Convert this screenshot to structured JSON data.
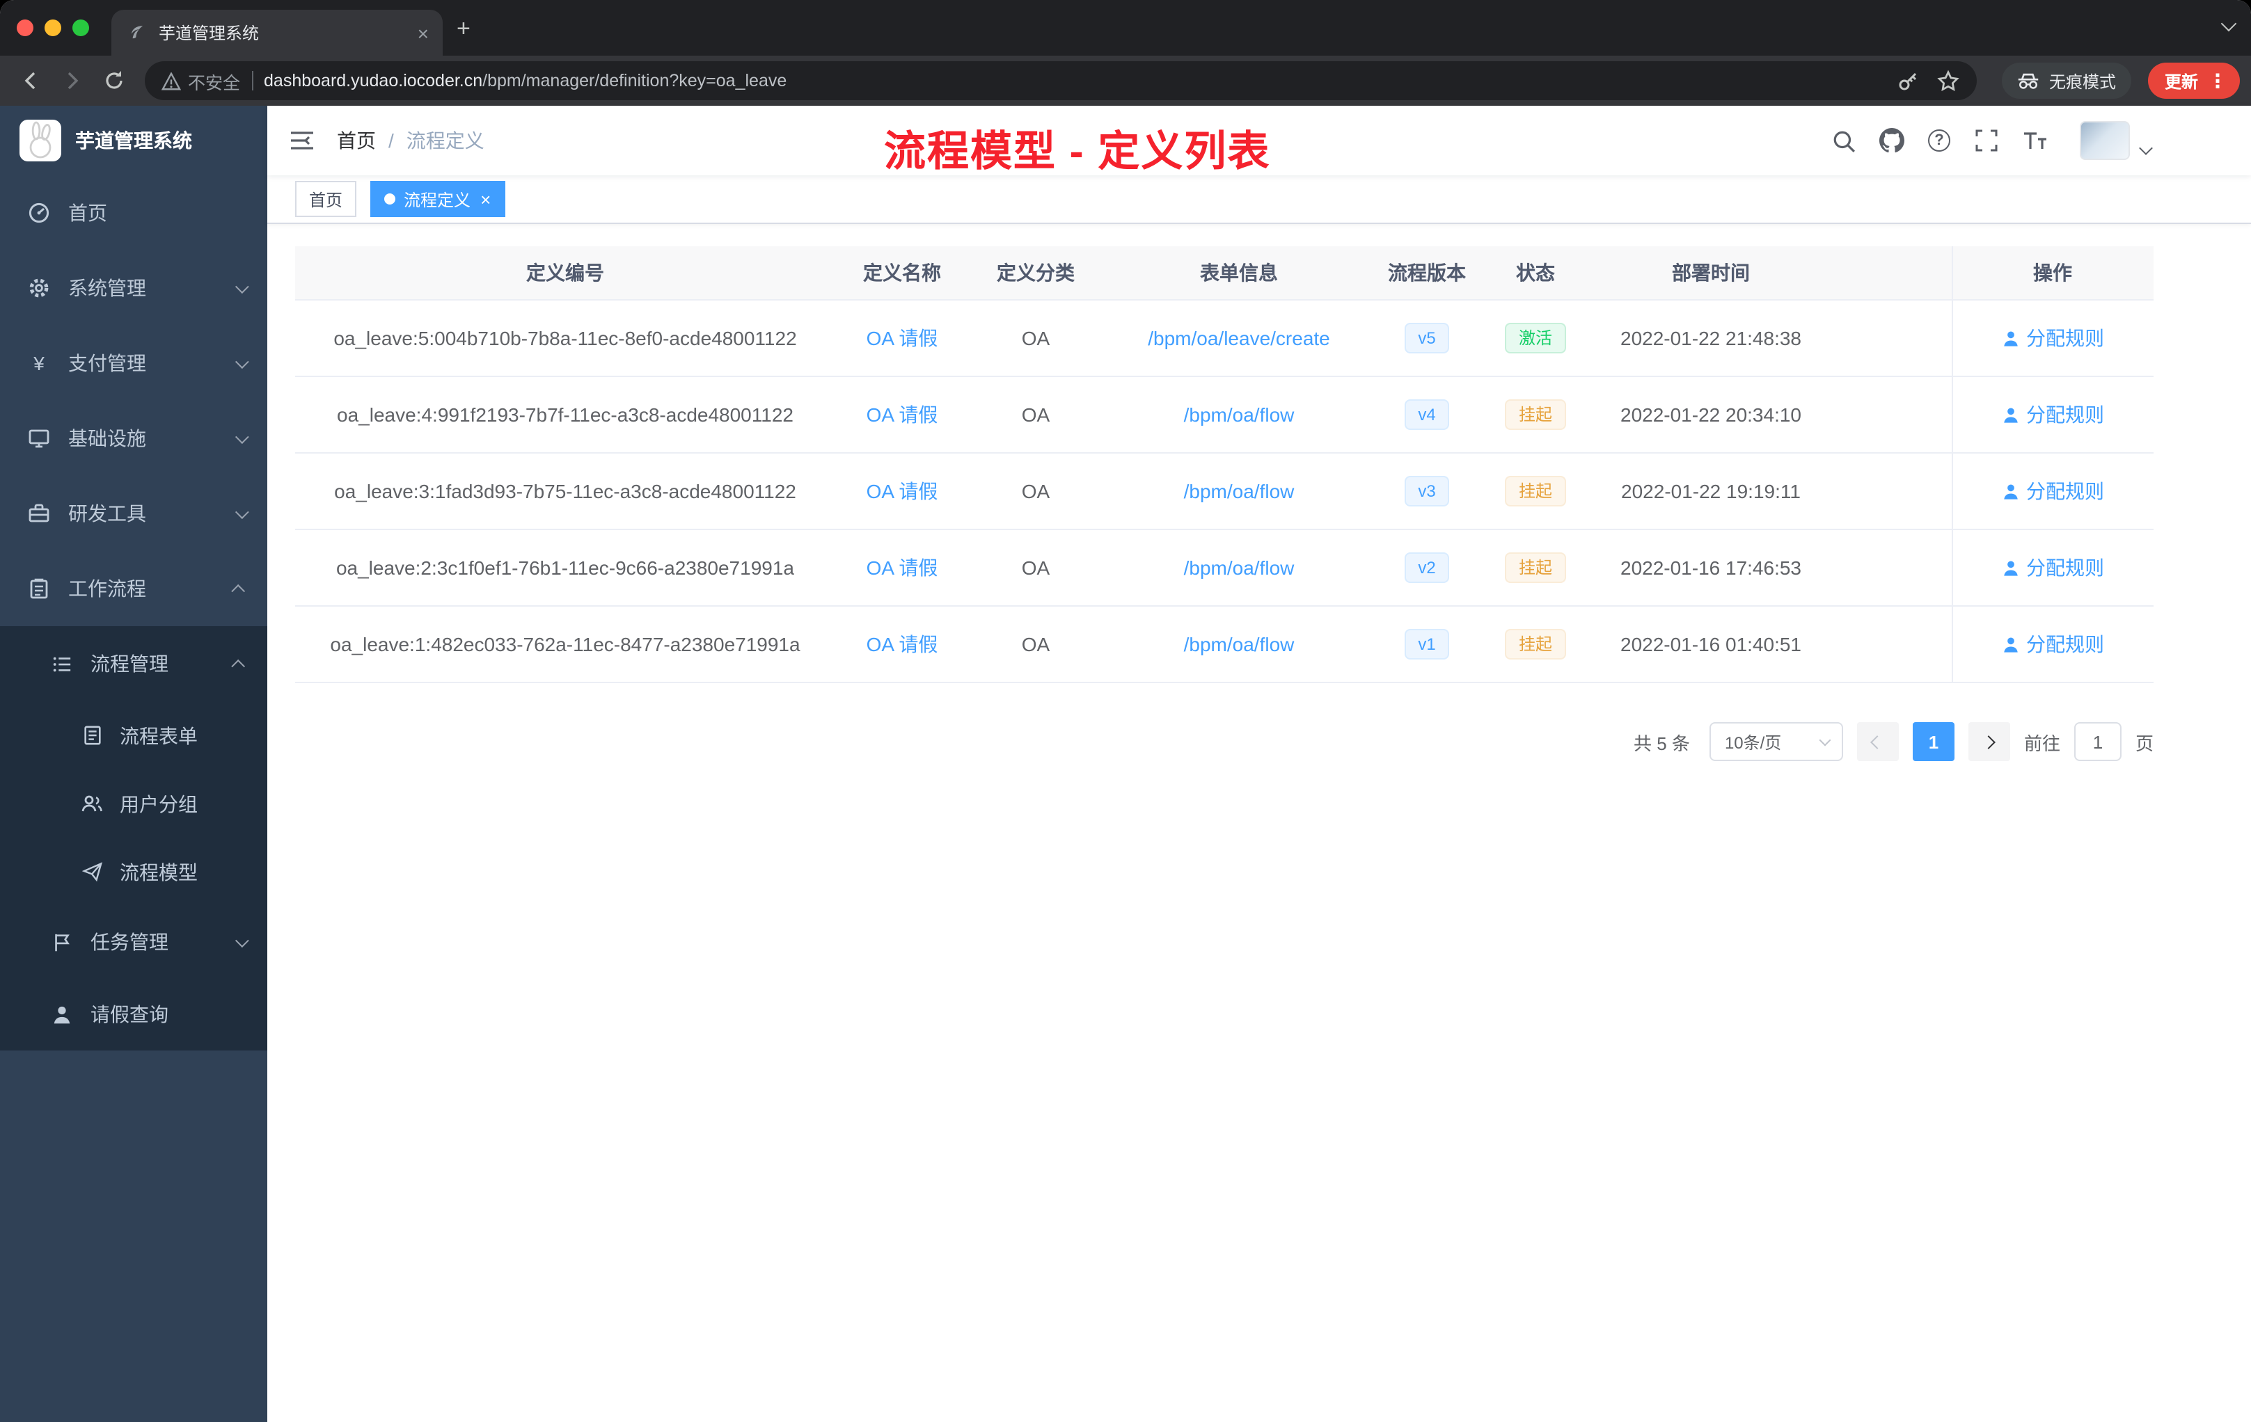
{
  "colors": {
    "accent": "#409eff",
    "title_red": "#f5222d",
    "success": "#13ce66",
    "warning": "#e6a23c",
    "sidebar_bg": "#304156",
    "submenu_bg": "#1f2d3d"
  },
  "chrome": {
    "tab_title": "芋道管理系统",
    "security_label": "不安全",
    "url_host": "dashboard.yudao.iocoder.cn",
    "url_path": "/bpm/manager/definition?key=oa_leave",
    "incognito_label": "无痕模式",
    "update_label": "更新"
  },
  "sidebar": {
    "logo_title": "芋道管理系统",
    "items": [
      {
        "label": "首页"
      },
      {
        "label": "系统管理"
      },
      {
        "label": "支付管理"
      },
      {
        "label": "基础设施"
      },
      {
        "label": "研发工具"
      },
      {
        "label": "工作流程"
      }
    ],
    "process": {
      "label": "流程管理",
      "children": [
        {
          "label": "流程表单"
        },
        {
          "label": "用户分组"
        },
        {
          "label": "流程模型"
        }
      ]
    },
    "tail": [
      {
        "label": "任务管理"
      },
      {
        "label": "请假查询"
      }
    ]
  },
  "topbar": {
    "breadcrumb_home": "首页",
    "breadcrumb_sep": "/",
    "breadcrumb_current": "流程定义",
    "overlay_title": "流程模型 - 定义列表"
  },
  "tags": [
    {
      "label": "首页"
    },
    {
      "label": "流程定义"
    }
  ],
  "table": {
    "columns": [
      "定义编号",
      "定义名称",
      "定义分类",
      "表单信息",
      "流程版本",
      "状态",
      "部署时间",
      "操作"
    ],
    "rows": [
      {
        "id": "oa_leave:5:004b710b-7b8a-11ec-8ef0-acde48001122",
        "name": "OA 请假",
        "category": "OA",
        "form": "/bpm/oa/leave/create",
        "version": "v5",
        "status": "激活",
        "time": "2022-01-22 21:48:38",
        "action": "分配规则"
      },
      {
        "id": "oa_leave:4:991f2193-7b7f-11ec-a3c8-acde48001122",
        "name": "OA 请假",
        "category": "OA",
        "form": "/bpm/oa/flow",
        "version": "v4",
        "status": "挂起",
        "time": "2022-01-22 20:34:10",
        "action": "分配规则"
      },
      {
        "id": "oa_leave:3:1fad3d93-7b75-11ec-a3c8-acde48001122",
        "name": "OA 请假",
        "category": "OA",
        "form": "/bpm/oa/flow",
        "version": "v3",
        "status": "挂起",
        "time": "2022-01-22 19:19:11",
        "action": "分配规则"
      },
      {
        "id": "oa_leave:2:3c1f0ef1-76b1-11ec-9c66-a2380e71991a",
        "name": "OA 请假",
        "category": "OA",
        "form": "/bpm/oa/flow",
        "version": "v2",
        "status": "挂起",
        "time": "2022-01-16 17:46:53",
        "action": "分配规则"
      },
      {
        "id": "oa_leave:1:482ec033-762a-11ec-8477-a2380e71991a",
        "name": "OA 请假",
        "category": "OA",
        "form": "/bpm/oa/flow",
        "version": "v1",
        "status": "挂起",
        "time": "2022-01-16 01:40:51",
        "action": "分配规则"
      }
    ]
  },
  "pagination": {
    "total": "共 5 条",
    "page_size": "10条/页",
    "current_page": "1",
    "goto_label": "前往",
    "goto_value": "1",
    "page_unit": "页"
  }
}
